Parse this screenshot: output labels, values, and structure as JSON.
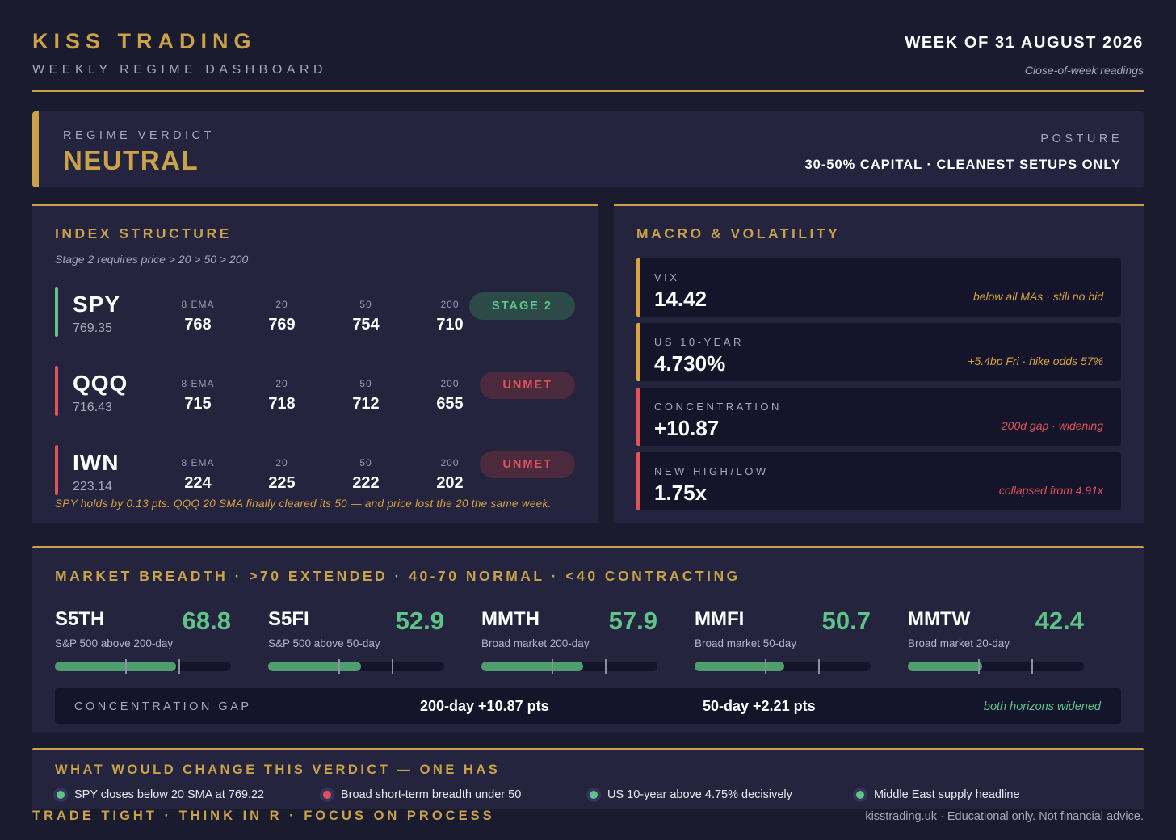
{
  "header": {
    "brand": "KISS TRADING",
    "subtitle": "WEEKLY REGIME DASHBOARD",
    "week": "WEEK OF 31 AUGUST 2026",
    "readings": "Close-of-week readings"
  },
  "verdict": {
    "label": "REGIME VERDICT",
    "value": "NEUTRAL",
    "posture_label": "POSTURE",
    "posture_value": "30-50% CAPITAL · CLEANEST SETUPS ONLY"
  },
  "index_structure": {
    "title": "INDEX STRUCTURE",
    "note": "Stage 2 requires price > 20 > 50 > 200",
    "rows": [
      {
        "ticker": "SPY",
        "price": "769.35",
        "ema8_label": "8 EMA",
        "ema8": "768",
        "sma20_label": "20",
        "sma20": "769",
        "sma50_label": "50",
        "sma50": "754",
        "sma200_label": "200",
        "sma200": "710",
        "status": "STAGE 2",
        "status_kind": "good"
      },
      {
        "ticker": "QQQ",
        "price": "716.43",
        "ema8_label": "8 EMA",
        "ema8": "715",
        "sma20_label": "20",
        "sma20": "718",
        "sma50_label": "50",
        "sma50": "712",
        "sma200_label": "200",
        "sma200": "655",
        "status": "UNMET",
        "status_kind": "bad"
      },
      {
        "ticker": "IWN",
        "price": "223.14",
        "ema8_label": "8 EMA",
        "ema8": "224",
        "sma20_label": "20",
        "sma20": "225",
        "sma50_label": "50",
        "sma50": "222",
        "sma200_label": "200",
        "sma200": "202",
        "status": "UNMET",
        "status_kind": "bad"
      }
    ],
    "footnote": "SPY holds by 0.13 pts. QQQ 20 SMA finally cleared its 50 — and price lost the 20 the same week."
  },
  "macro": {
    "title": "MACRO & VOLATILITY",
    "cards": [
      {
        "label": "VIX",
        "value": "14.42",
        "note": "below all MAs · still no bid",
        "tone": "gold"
      },
      {
        "label": "US 10-YEAR",
        "value": "4.730%",
        "note": "+5.4bp Fri · hike odds 57%",
        "tone": "gold"
      },
      {
        "label": "CONCENTRATION",
        "value": "+10.87",
        "note": "200d gap · widening",
        "tone": "red"
      },
      {
        "label": "NEW HIGH/LOW",
        "value": "1.75x",
        "note": "collapsed from 4.91x",
        "tone": "red"
      }
    ]
  },
  "breadth": {
    "title": "MARKET BREADTH · >70 EXTENDED · 40-70 NORMAL · <40 CONTRACTING",
    "items": [
      {
        "name": "S5TH",
        "value": "68.8",
        "desc": "S&P 500 above 200-day",
        "fill": 0.688
      },
      {
        "name": "S5FI",
        "value": "52.9",
        "desc": "S&P 500 above 50-day",
        "fill": 0.529
      },
      {
        "name": "MMTH",
        "value": "57.9",
        "desc": "Broad market 200-day",
        "fill": 0.579
      },
      {
        "name": "MMFI",
        "value": "50.7",
        "desc": "Broad market 50-day",
        "fill": 0.507
      },
      {
        "name": "MMTW",
        "value": "42.4",
        "desc": "Broad market 20-day",
        "fill": 0.424
      }
    ],
    "thresholds": [
      0.4,
      0.7
    ],
    "gap": {
      "label": "CONCENTRATION GAP",
      "a": "200-day +10.87 pts",
      "b": "50-day +2.21 pts",
      "note": "both horizons widened"
    }
  },
  "change": {
    "title": "WHAT WOULD CHANGE THIS VERDICT — ONE HAS",
    "items": [
      {
        "text": "SPY closes below 20 SMA at 769.22",
        "status": "green"
      },
      {
        "text": "Broad short-term breadth under 50",
        "status": "red"
      },
      {
        "text": "US 10-year above 4.75% decisively",
        "status": "green"
      },
      {
        "text": "Middle East supply headline",
        "status": "green"
      }
    ]
  },
  "footer": {
    "left": "TRADE TIGHT · THINK IN R · FOCUS ON PROCESS",
    "right": "kisstrading.uk · Educational only. Not financial advice."
  },
  "colors": {
    "gold": "#c9a24a",
    "green": "#5ec48a",
    "red": "#e0535a",
    "amber": "#d9a441"
  }
}
